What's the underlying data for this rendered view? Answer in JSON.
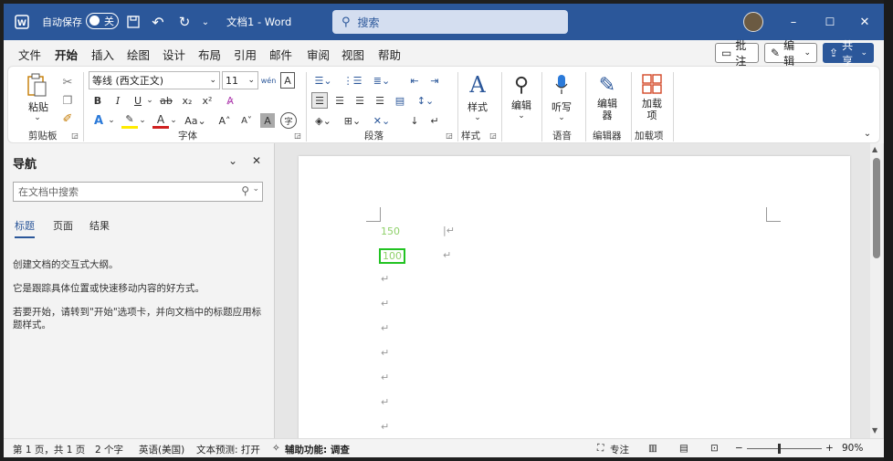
{
  "titlebar": {
    "autosave_label": "自动保存",
    "autosave_state": "关",
    "doc_title": "文档1 - Word",
    "search_placeholder": "搜索",
    "minimize": "–",
    "maximize": "☐",
    "close": "✕"
  },
  "menu": {
    "items": [
      "文件",
      "开始",
      "插入",
      "绘图",
      "设计",
      "布局",
      "引用",
      "邮件",
      "审阅",
      "视图",
      "帮助"
    ],
    "active": "开始",
    "comment_label": "批注",
    "edit_label": "编辑",
    "share_label": "共享"
  },
  "ribbon": {
    "clipboard": {
      "paste_label": "粘贴",
      "group_label": "剪贴板"
    },
    "font": {
      "font_name": "等线 (西文正文)",
      "font_size": "11",
      "group_label": "字体"
    },
    "paragraph": {
      "group_label": "段落"
    },
    "styles": {
      "styles_label": "样式",
      "group_label": "样式"
    },
    "editing": {
      "label": "编辑"
    },
    "voice": {
      "dictate_label": "听写",
      "group_label": "语音"
    },
    "editor": {
      "label": "编辑器",
      "group_label": "编辑器"
    },
    "addins": {
      "label": "加载项",
      "group_label": "加载项"
    }
  },
  "nav": {
    "title": "导航",
    "search_placeholder": "在文档中搜索",
    "tabs": [
      "标题",
      "页面",
      "结果"
    ],
    "active_tab": "标题",
    "paragraphs": [
      "创建文档的交互式大纲。",
      "它是跟踪具体位置或快速移动内容的好方式。",
      "若要开始，请转到\"开始\"选项卡，并向文档中的标题应用标题样式。"
    ]
  },
  "document": {
    "line1": "150",
    "line2": "100",
    "line_color": "#8fd16a",
    "highlight_color": "#22c322"
  },
  "status": {
    "page": "第 1 页，共 1 页",
    "words": "2 个字",
    "language": "英语(美国)",
    "prediction": "文本预测: 打开",
    "accessibility": "辅助功能: 调查",
    "focus": "专注",
    "zoom": "90%"
  },
  "colors": {
    "accent": "#2b579a"
  }
}
